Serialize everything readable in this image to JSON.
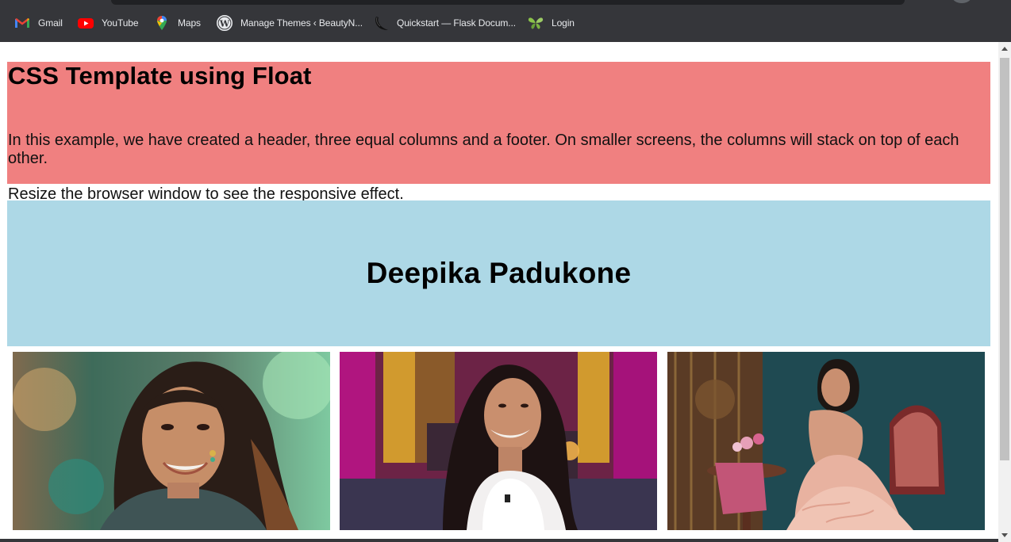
{
  "bookmarks": [
    {
      "label": "Gmail",
      "icon": "gmail-icon"
    },
    {
      "label": "YouTube",
      "icon": "youtube-icon"
    },
    {
      "label": "Maps",
      "icon": "maps-icon"
    },
    {
      "label": "Manage Themes ‹ BeautyN...",
      "icon": "wordpress-icon"
    },
    {
      "label": "Quickstart — Flask Docum...",
      "icon": "flask-icon"
    },
    {
      "label": "Login",
      "icon": "butterfly-icon"
    }
  ],
  "header": {
    "title": "CSS Template using Float",
    "paragraph1": "In this example, we have created a header, three equal columns and a footer. On smaller screens, the columns will stack on top of each other.",
    "paragraph2": "Resize the browser window to see the responsive effect."
  },
  "banner": {
    "name": "Deepika Padukone"
  },
  "colors": {
    "header_bg": "#f08080",
    "banner_bg": "#add8e6",
    "bookmarks_bg": "#35363a"
  }
}
